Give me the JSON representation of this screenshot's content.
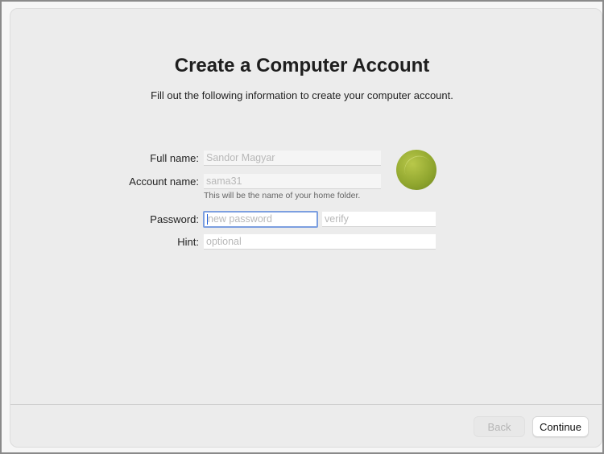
{
  "title": "Create a Computer Account",
  "subtitle": "Fill out the following information to create your computer account.",
  "form": {
    "full_name": {
      "label": "Full name:",
      "value": "Sandor Magyar"
    },
    "account_name": {
      "label": "Account name:",
      "value": "sama31",
      "help": "This will be the name of your home folder."
    },
    "password": {
      "label": "Password:",
      "placeholder": "new password",
      "verify_placeholder": "verify"
    },
    "hint": {
      "label": "Hint:",
      "placeholder": "optional"
    }
  },
  "buttons": {
    "back": "Back",
    "continue": "Continue"
  },
  "colors": {
    "focus_ring": "#7c9fe0",
    "window_bg": "#ececec"
  }
}
